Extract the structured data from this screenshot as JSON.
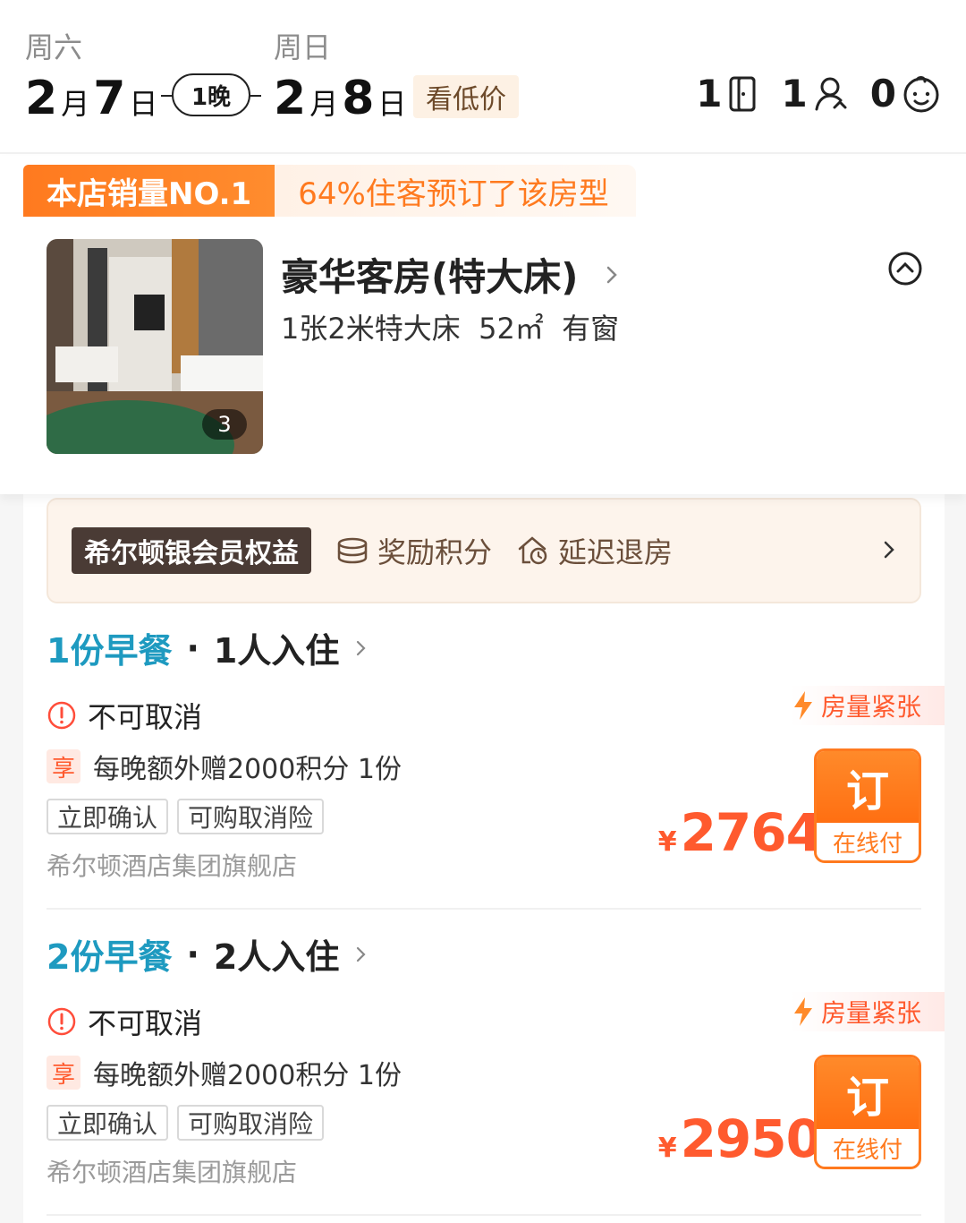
{
  "header": {
    "checkin": {
      "weekday": "周六",
      "month": "2",
      "month_unit": "月",
      "day": "7",
      "day_unit": "日"
    },
    "checkout": {
      "weekday": "周日",
      "month": "2",
      "month_unit": "月",
      "day": "8",
      "day_unit": "日"
    },
    "nights_label": "1晚",
    "low_price_label": "看低价",
    "rooms_count": "1",
    "adults_count": "1",
    "children_count": "0"
  },
  "room": {
    "sales_badge": "本店销量NO.1",
    "booked_share": "64%住客预订了该房型",
    "photo_count": "3",
    "title": "豪华客房(特大床)",
    "bed": "1张2米特大床",
    "area": "52㎡",
    "window": "有窗"
  },
  "member": {
    "tag": "希尔顿银会员权益",
    "perk1": "奖励积分",
    "perk2": "延迟退房"
  },
  "plans": [
    {
      "meal": "1份早餐",
      "guests": "1人入住",
      "cancel": "不可取消",
      "enjoy_tag": "享",
      "enjoy_text": "每晚额外赠2000积分 1份",
      "tags": [
        "立即确认",
        "可购取消险"
      ],
      "vendor": "希尔顿酒店集团旗舰店",
      "scarcity": "房量紧张",
      "currency": "¥",
      "price": "2764",
      "book_label": "订",
      "pay_label": "在线付"
    },
    {
      "meal": "2份早餐",
      "guests": "2人入住",
      "cancel": "不可取消",
      "enjoy_tag": "享",
      "enjoy_text": "每晚额外赠2000积分 1份",
      "tags": [
        "立即确认",
        "可购取消险"
      ],
      "vendor": "希尔顿酒店集团旗舰店",
      "scarcity": "房量紧张",
      "currency": "¥",
      "price": "2950",
      "book_label": "订",
      "pay_label": "在线付"
    }
  ],
  "colors": {
    "accent_orange": "#ff7a1f",
    "price_red": "#ff5a2e",
    "meal_blue": "#1e9ac0",
    "member_brown": "#4a3b35"
  },
  "icons": [
    "door-icon",
    "person-icon",
    "child-face-icon",
    "chevron-right-icon",
    "chevron-up-circle-icon",
    "coins-icon",
    "home-clock-icon",
    "alert-circle-icon",
    "lightning-icon"
  ]
}
